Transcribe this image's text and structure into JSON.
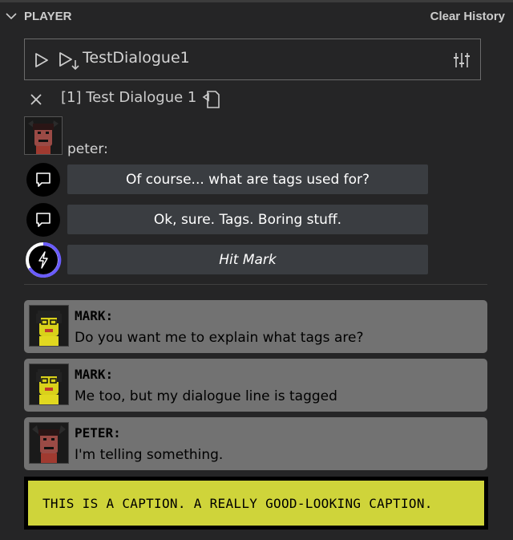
{
  "panel": {
    "title": "PLAYER",
    "clear_label": "Clear History"
  },
  "player": {
    "dialogue_name": "TestDialogue1",
    "dialogue_title": "[1] Test Dialogue 1"
  },
  "choice": {
    "speaker": "peter:",
    "options": [
      {
        "label": "Of course... what are tags used for?",
        "icon": "speech-bubble-icon"
      },
      {
        "label": "Ok, sure. Tags. Boring stuff.",
        "icon": "speech-bubble-icon"
      },
      {
        "label": "Hit Mark",
        "icon": "lightning-icon"
      }
    ]
  },
  "history": [
    {
      "speaker": "MARK:",
      "text": "Do you want me to explain what tags are?",
      "avatar": "mark-avatar"
    },
    {
      "speaker": "MARK:",
      "text": "Me too, but my dialogue line is tagged",
      "avatar": "mark-avatar"
    },
    {
      "speaker": "PETER:",
      "text": "I'm telling something.",
      "avatar": "peter-avatar"
    }
  ],
  "caption": {
    "text": "THIS IS A CAPTION. A REALLY GOOD-LOOKING CAPTION."
  },
  "colors": {
    "background": "#252526",
    "option_bg": "#3a3d41",
    "history_bg": "#727272",
    "caption_bg": "#cfd43a",
    "timer_ring": "#6a5cff"
  }
}
